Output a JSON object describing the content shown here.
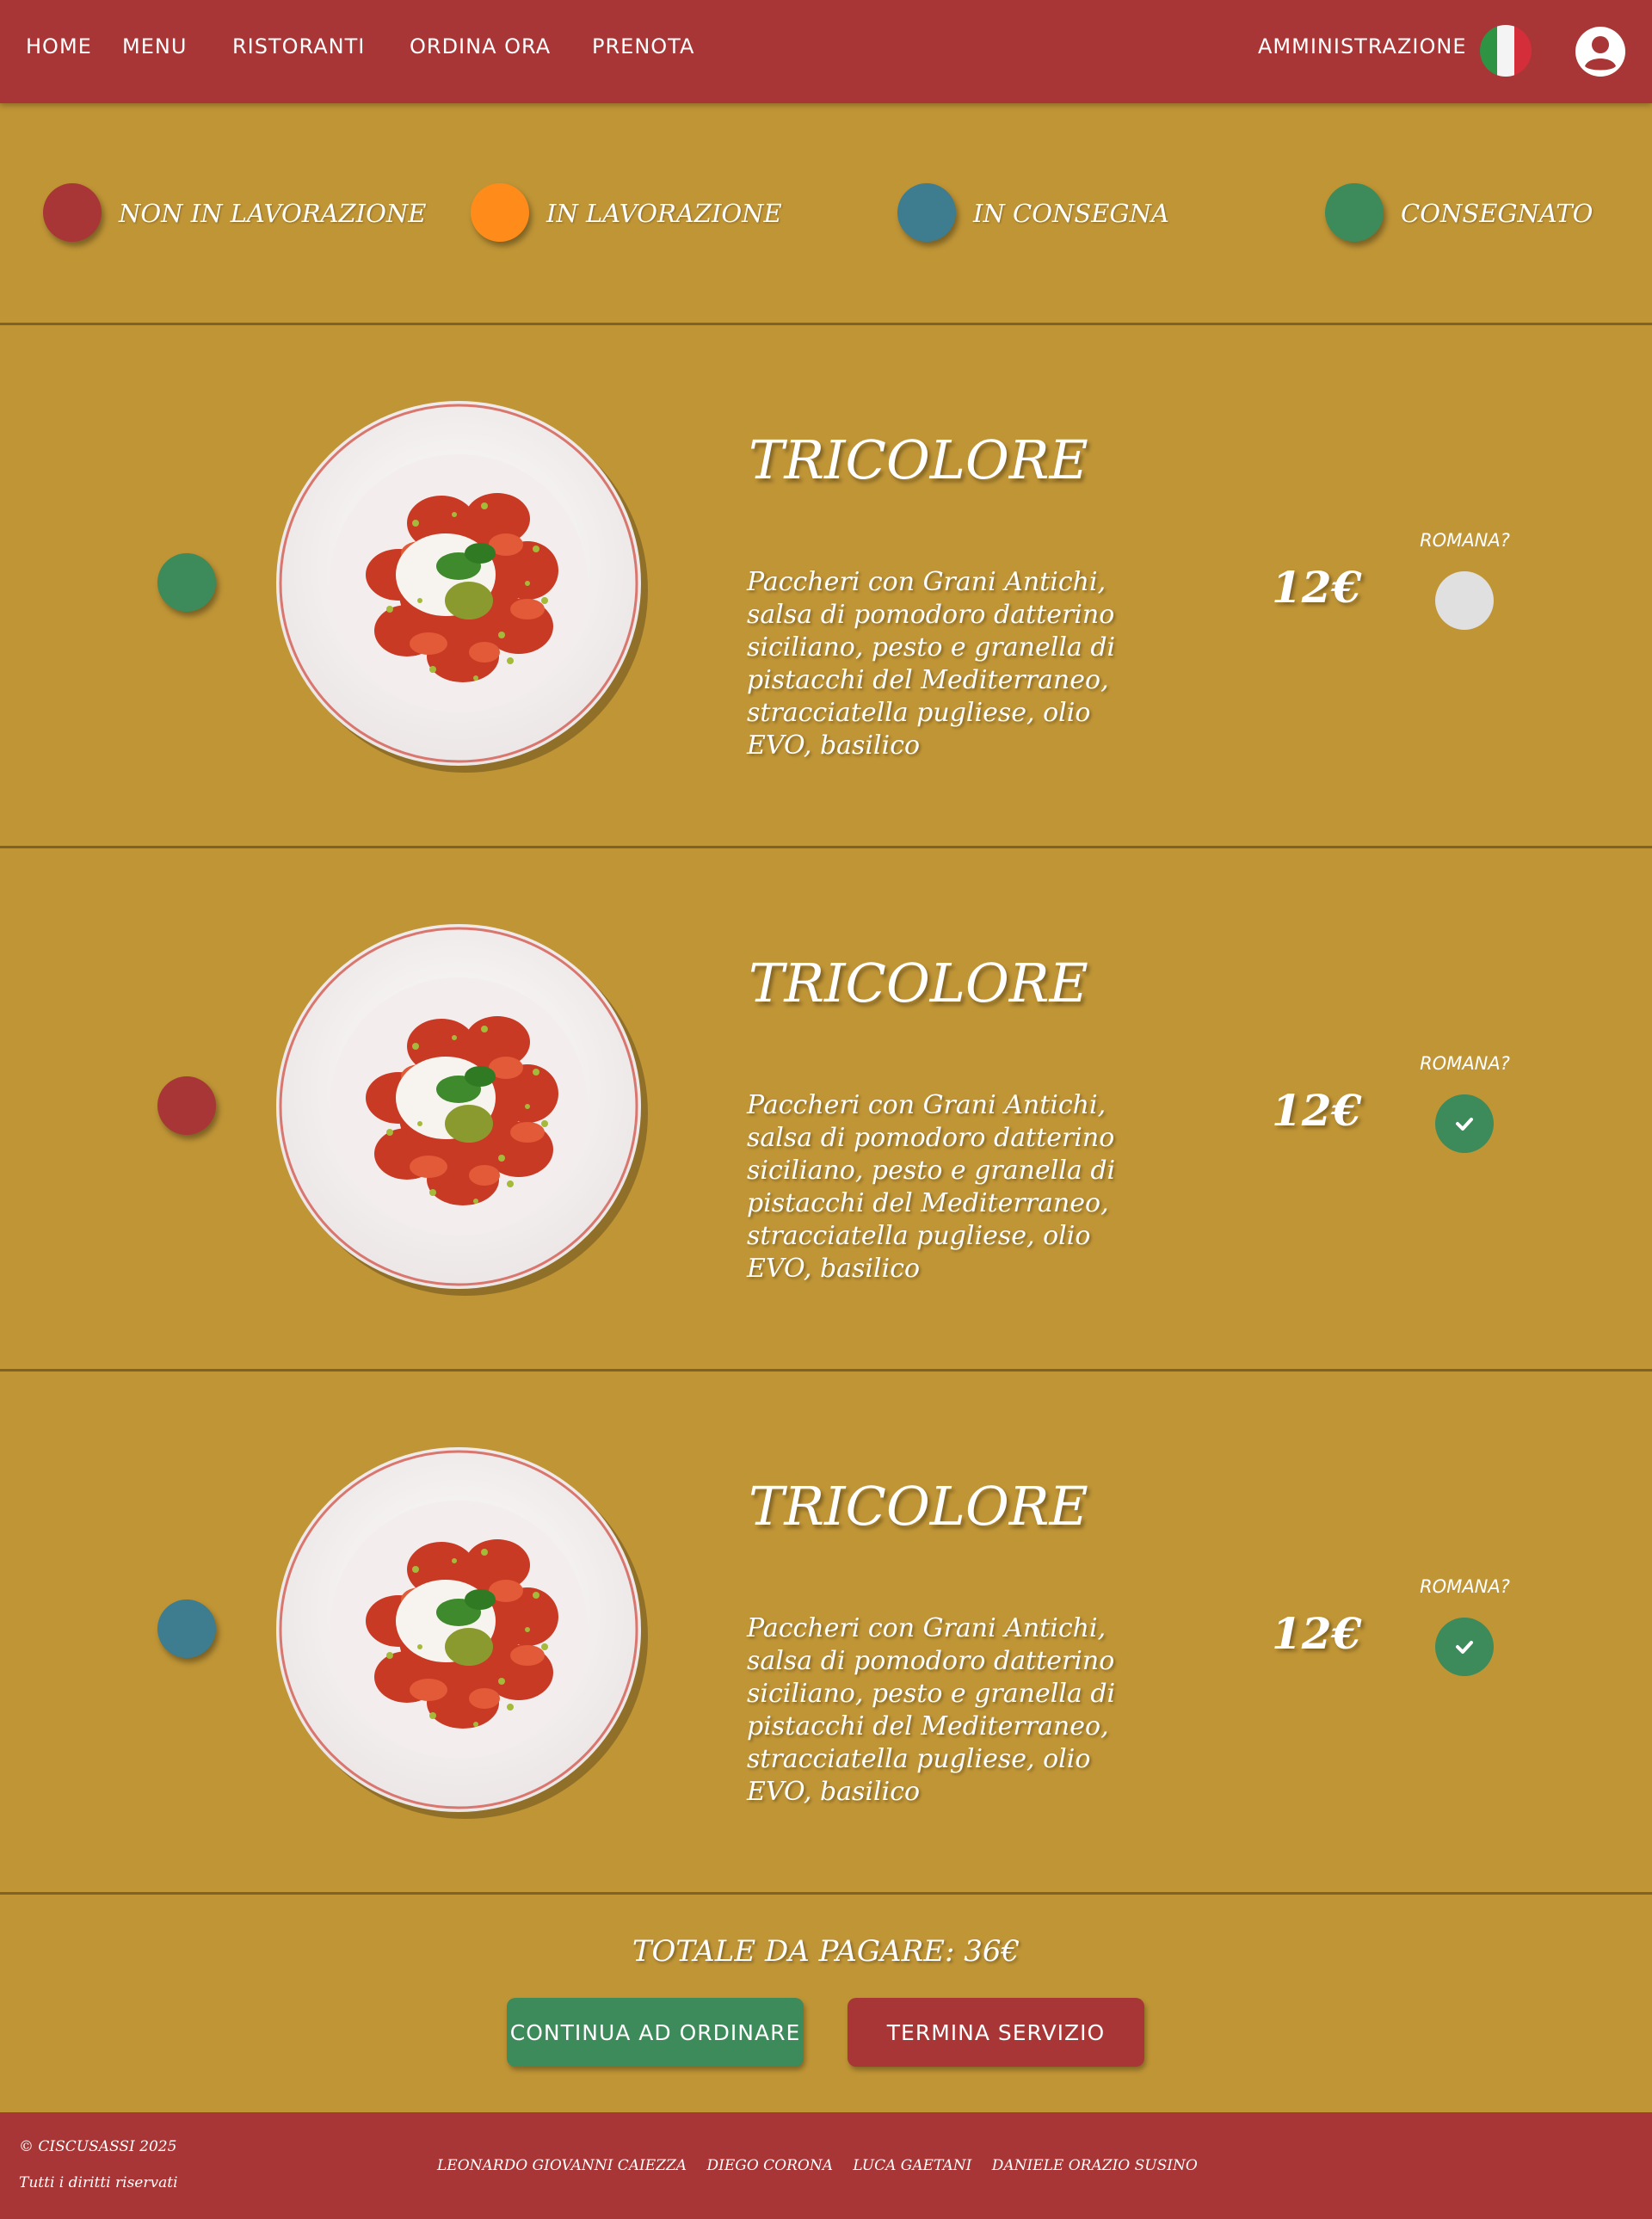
{
  "nav": {
    "links": [
      "HOME",
      "MENU",
      "RISTORANTI",
      "ORDINA ORA",
      "PRENOTA"
    ],
    "admin": "AMMINISTRAZIONE"
  },
  "legend": [
    {
      "label": "NON IN LAVORAZIONE",
      "color": "#a83636"
    },
    {
      "label": "IN LAVORAZIONE",
      "color": "#ff8c1a"
    },
    {
      "label": "IN CONSEGNA",
      "color": "#3d7d8f"
    },
    {
      "label": "CONSEGNATO",
      "color": "#3d8a5a"
    }
  ],
  "orders": [
    {
      "title": "TRICOLORE",
      "description": "Paccheri con Grani Antichi, salsa di pomodoro datterino siciliano, pesto e granella di pistacchi del Mediterraneo, stracciatella pugliese, olio EVO, basilico",
      "price": "12€",
      "romana_label": "ROMANA?",
      "romana_checked": false,
      "status": "CONSEGNATO",
      "status_color": "#3d8a5a"
    },
    {
      "title": "TRICOLORE",
      "description": "Paccheri con Grani Antichi, salsa di pomodoro datterino siciliano, pesto e granella di pistacchi del Mediterraneo, stracciatella pugliese, olio EVO, basilico",
      "price": "12€",
      "romana_label": "ROMANA?",
      "romana_checked": true,
      "status": "NON IN LAVORAZIONE",
      "status_color": "#a83636"
    },
    {
      "title": "TRICOLORE",
      "description": "Paccheri con Grani Antichi, salsa di pomodoro datterino siciliano, pesto e granella di pistacchi del Mediterraneo, stracciatella pugliese, olio EVO, basilico",
      "price": "12€",
      "romana_label": "ROMANA?",
      "romana_checked": true,
      "status": "IN CONSEGNA",
      "status_color": "#3d7d8f"
    }
  ],
  "total": "TOTALE DA PAGARE: 36€",
  "buttons": {
    "continue": "CONTINUA AD ORDINARE",
    "end": "TERMINA SERVIZIO"
  },
  "footer": {
    "copyright": "© CISCUSASSI 2025",
    "rights": "Tutti i diritti riservati",
    "authors": [
      "LEONARDO GIOVANNI CAIEZZA",
      "DIEGO CORONA",
      "LUCA GAETANI",
      "DANIELE ORAZIO SUSINO"
    ]
  },
  "colors": {
    "nav_bg": "#a83636",
    "page_bg": "#c09536",
    "button_green": "#3d8a5a",
    "button_red": "#a83636",
    "unchecked": "#e0e0e0"
  }
}
